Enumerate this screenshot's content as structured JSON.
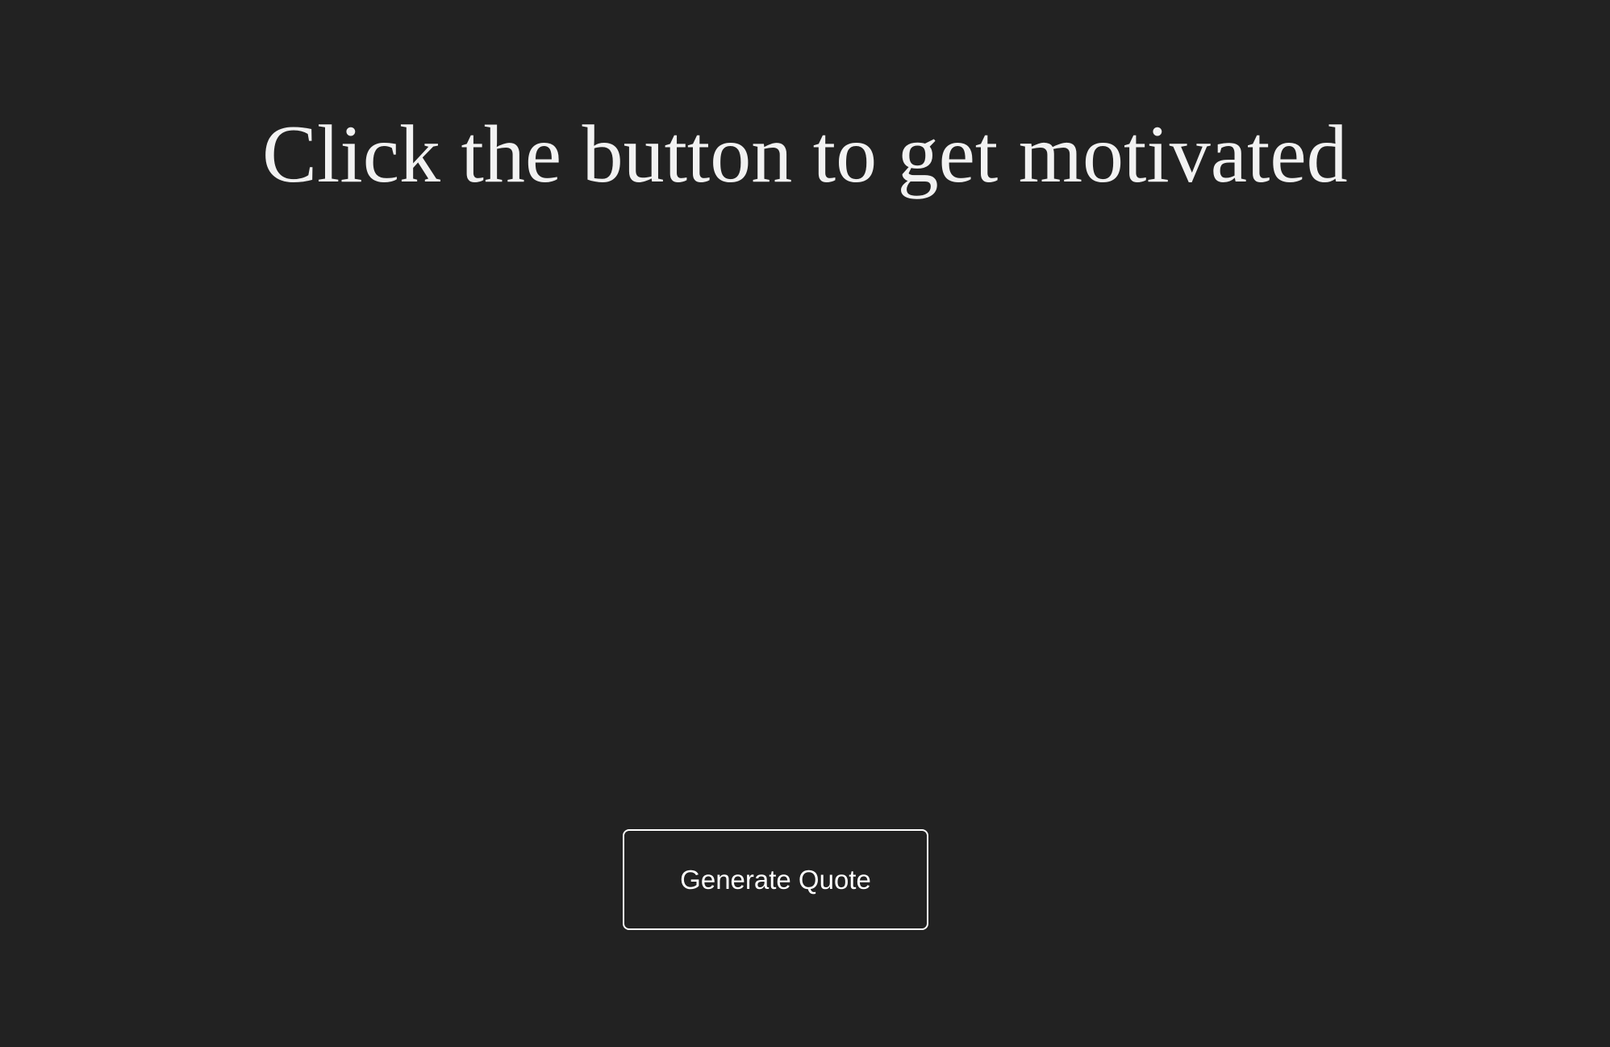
{
  "page": {
    "title": "Click the button to get motivated",
    "quote_text": "",
    "generate_button_label": "Generate Quote"
  },
  "colors": {
    "background": "#222222",
    "text": "#f2f2f2",
    "button_border": "#ffffff"
  }
}
